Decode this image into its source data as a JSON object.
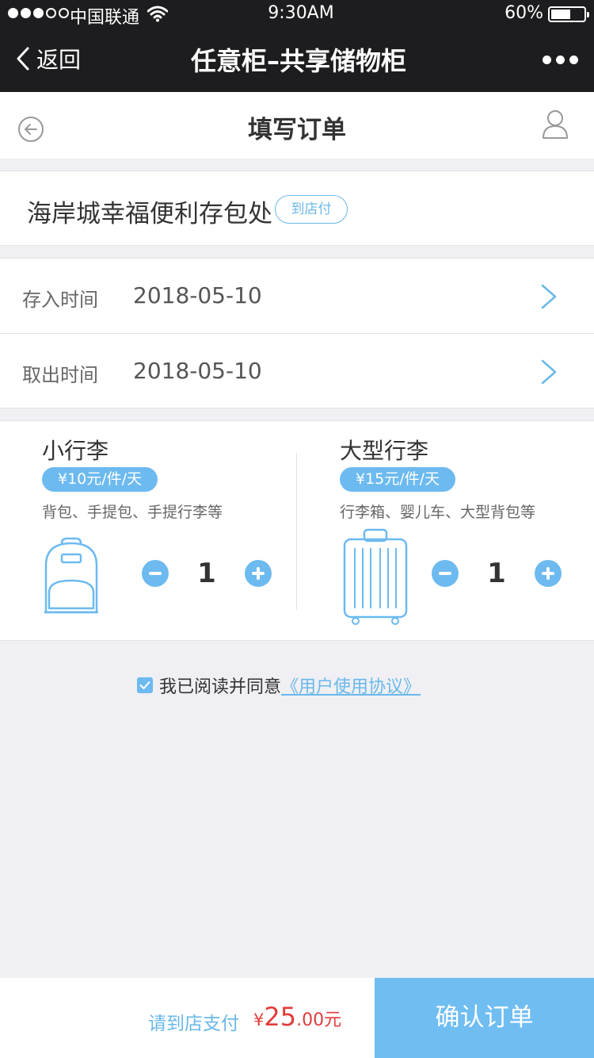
{
  "status_bar": {
    "carrier": "中国联通",
    "time": "9:30AM",
    "battery": "60%",
    "battery_level": 0.6
  },
  "nav": {
    "back_label": "返回",
    "title": "任意柜–共享储物柜"
  },
  "page": {
    "title": "填写订单"
  },
  "store": {
    "name": "海岸城幸福便利存包处",
    "pay_tag": "到店付"
  },
  "times": [
    {
      "label": "存入时间",
      "value": "2018-05-10"
    },
    {
      "label": "取出时间",
      "value": "2018-05-10"
    }
  ],
  "luggage": [
    {
      "title": "小行李",
      "price": "¥10元/件/天",
      "desc": "背包、手提包、手提行李等",
      "quantity": "1",
      "icon": "backpack-icon"
    },
    {
      "title": "大型行李",
      "price": "¥15元/件/天",
      "desc": "行李箱、婴儿车、大型背包等",
      "quantity": "1",
      "icon": "suitcase-icon"
    }
  ],
  "agreement": {
    "checked": true,
    "text": "我已阅读并同意",
    "link": "《用户使用协议》"
  },
  "footer": {
    "pay_label": "请到店支付",
    "currency": "¥",
    "amount_int": "25",
    "amount_dec": ".00",
    "unit": "元",
    "confirm_label": "确认订单"
  },
  "colors": {
    "accent": "#6cbaf0",
    "price": "#e23b3b",
    "topbar": "#1d1d1f",
    "background": "#efeff4"
  }
}
